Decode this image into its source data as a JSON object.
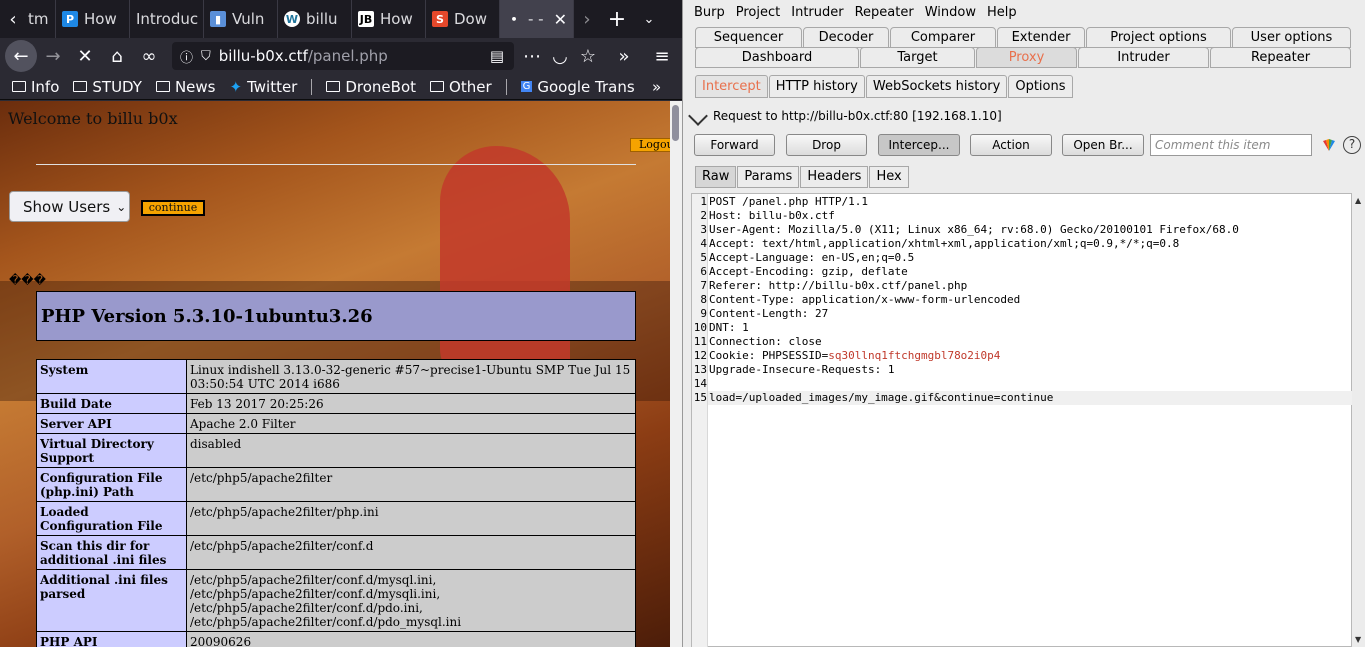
{
  "browser": {
    "tabs": [
      {
        "title": "tm",
        "icon": "generic"
      },
      {
        "title": "How",
        "icon": "P"
      },
      {
        "title": "Introduc",
        "icon": ""
      },
      {
        "title": "Vuln",
        "icon": "doc"
      },
      {
        "title": "billu",
        "icon": "W"
      },
      {
        "title": "How",
        "icon": "JB"
      },
      {
        "title": "Dow",
        "icon": "S"
      },
      {
        "title": "- - Mo",
        "icon": "dot"
      }
    ],
    "url_host": "billu-b0x.ctf",
    "url_path": "/panel.php",
    "bookmarks": [
      "Info",
      "STUDY",
      "News",
      "Twitter",
      "DroneBot",
      "Other",
      "Google Trans"
    ]
  },
  "page": {
    "welcome": "Welcome to billu b0x",
    "logout": "Logout",
    "show_users": "Show Users",
    "continue": "continue",
    "garble": "���",
    "php_title": "PHP Version 5.3.10-1ubuntu3.26",
    "info_rows": [
      {
        "k": "System",
        "v": "Linux indishell 3.13.0-32-generic #57~precise1-Ubuntu SMP Tue Jul 15 03:50:54 UTC 2014 i686"
      },
      {
        "k": "Build Date",
        "v": "Feb 13 2017 20:25:26"
      },
      {
        "k": "Server API",
        "v": "Apache 2.0 Filter"
      },
      {
        "k": "Virtual Directory Support",
        "v": "disabled"
      },
      {
        "k": "Configuration File (php.ini) Path",
        "v": "/etc/php5/apache2filter"
      },
      {
        "k": "Loaded Configuration File",
        "v": "/etc/php5/apache2filter/php.ini"
      },
      {
        "k": "Scan this dir for additional .ini files",
        "v": "/etc/php5/apache2filter/conf.d"
      },
      {
        "k": "Additional .ini files parsed",
        "v": "/etc/php5/apache2filter/conf.d/mysql.ini, /etc/php5/apache2filter/conf.d/mysqli.ini, /etc/php5/apache2filter/conf.d/pdo.ini, /etc/php5/apache2filter/conf.d/pdo_mysql.ini"
      },
      {
        "k": "PHP API",
        "v": "20090626"
      }
    ]
  },
  "burp": {
    "menu": [
      "Burp",
      "Project",
      "Intruder",
      "Repeater",
      "Window",
      "Help"
    ],
    "tabs_row1": [
      "Sequencer",
      "Decoder",
      "Comparer",
      "Extender",
      "Project options",
      "User options"
    ],
    "tabs_row2": [
      "Dashboard",
      "Target",
      "Proxy",
      "Intruder",
      "Repeater"
    ],
    "selected_tab": "Proxy",
    "subtabs": [
      "Intercept",
      "HTTP history",
      "WebSockets history",
      "Options"
    ],
    "request_info": "Request to http://billu-b0x.ctf:80  [192.168.1.10]",
    "buttons": [
      "Forward",
      "Drop",
      "Intercep...",
      "Action",
      "Open Br..."
    ],
    "comment_placeholder": "Comment this item",
    "help": "?",
    "view_tabs": [
      "Raw",
      "Params",
      "Headers",
      "Hex"
    ],
    "request_lines": [
      {
        "n": "1",
        "text": "POST /panel.php HTTP/1.1"
      },
      {
        "n": "2",
        "key": "Host",
        "text": "billu-b0x.ctf"
      },
      {
        "n": "3",
        "key": "User-Agent",
        "text": "Mozilla/5.0 (X11; Linux x86_64; rv:68.0) Gecko/20100101 Firefox/68.0"
      },
      {
        "n": "4",
        "key": "Accept",
        "text": "text/html,application/xhtml+xml,application/xml;q=0.9,*/*;q=0.8"
      },
      {
        "n": "5",
        "key": "Accept-Language",
        "text": "en-US,en;q=0.5"
      },
      {
        "n": "6",
        "key": "Accept-Encoding",
        "text": "gzip, deflate"
      },
      {
        "n": "7",
        "key": "Referer",
        "text": "http://billu-b0x.ctf/panel.php"
      },
      {
        "n": "8",
        "key": "Content-Type",
        "text": "application/x-www-form-urlencoded"
      },
      {
        "n": "9",
        "key": "Content-Length",
        "text": "27"
      },
      {
        "n": "10",
        "key": "DNT",
        "text": "1"
      },
      {
        "n": "11",
        "key": "Connection",
        "text": "close"
      },
      {
        "n": "12",
        "key": "Cookie",
        "cookie_name": "PHPSESSID=",
        "text": "sq30llnq1ftchgmgbl78o2i0p4"
      },
      {
        "n": "13",
        "key": "Upgrade-Insecure-Requests",
        "text": "1"
      },
      {
        "n": "14",
        "text": ""
      },
      {
        "n": "15",
        "text": "load=/uploaded_images/my_image.gif&continue=continue"
      }
    ]
  },
  "colors": {
    "accent_orange": "#e8704c",
    "php_header": "#9999cc",
    "php_key": "#ccccff",
    "php_value": "#cccccc",
    "session_id": "#c0392b"
  }
}
